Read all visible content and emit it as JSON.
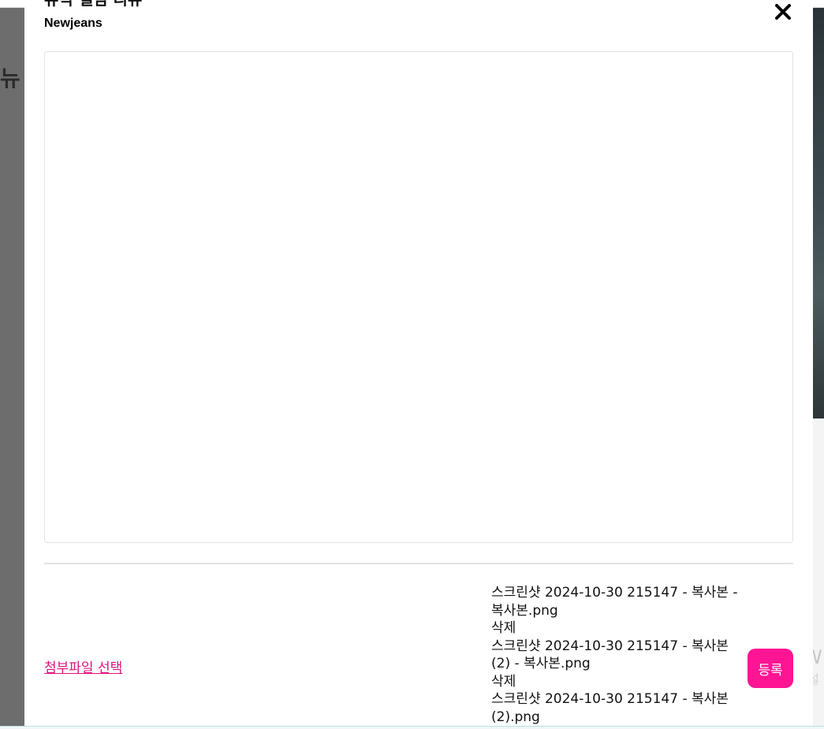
{
  "backdrop": {
    "left_text": "뉴",
    "right_text_1": "W",
    "right_text_2": "[설"
  },
  "modal": {
    "title_partial": "뮤직 앨범 리뷰",
    "artist": "Newjeans",
    "close_icon": "close-icon"
  },
  "footer": {
    "attach_label": "첨부파일 선택",
    "submit_label": "등록",
    "accent_color": "#ff1493"
  },
  "files": [
    {
      "name": "스크린샷 2024-10-30 215147 - 복사본 - 복사본.png",
      "delete_label": "삭제"
    },
    {
      "name": "스크린샷 2024-10-30 215147 - 복사본 (2) - 복사본.png",
      "delete_label": "삭제"
    },
    {
      "name": "스크린샷 2024-10-30 215147 - 복사본 (2).png"
    }
  ]
}
